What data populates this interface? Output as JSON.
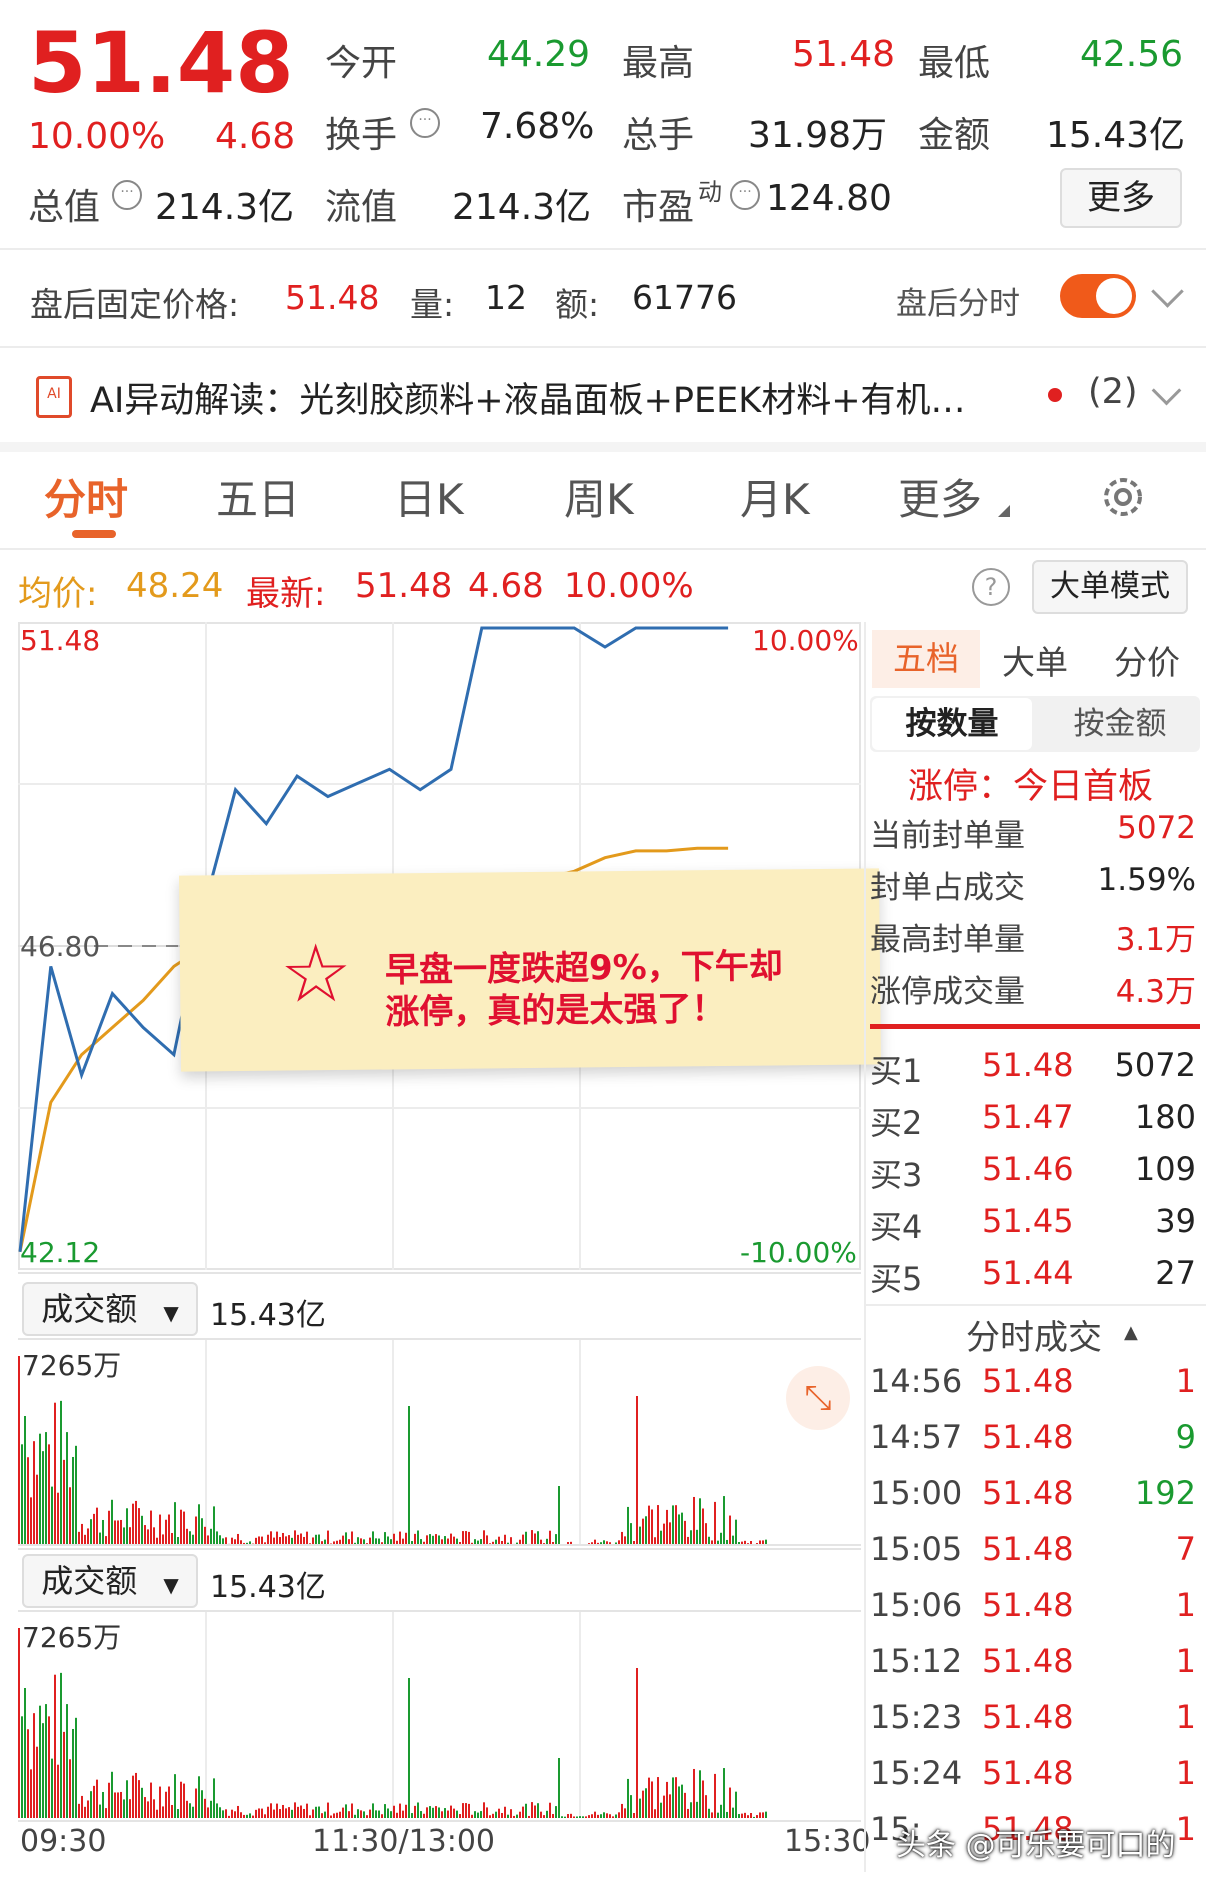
{
  "quote": {
    "price": "51.48",
    "change_pct": "10.00%",
    "change_amt": "4.68",
    "open_label": "今开",
    "open_value": "44.29",
    "high_label": "最高",
    "high_value": "51.48",
    "low_label": "最低",
    "low_value": "42.56",
    "turnover_label": "换手",
    "turnover_value": "7.68%",
    "total_hands_label": "总手",
    "total_hands_value": "31.98万",
    "amount_label": "金额",
    "amount_value": "15.43亿",
    "mktcap_label": "总值",
    "mktcap_value": "214.3亿",
    "float_label": "流值",
    "float_value": "214.3亿",
    "pe_label": "市盈",
    "pe_sup": "动",
    "pe_value": "124.80",
    "more_button": "更多"
  },
  "afterhours": {
    "price_label": "盘后固定价格:",
    "price_value": "51.48",
    "vol_label": "量:",
    "vol_value": "12",
    "amt_label": "额:",
    "amt_value": "61776",
    "timeshare_label": "盘后分时"
  },
  "ai": {
    "text": "AI异动解读：光刻胶颜料+液晶面板+PEEK材料+有机…",
    "count": "(2)"
  },
  "tabs": [
    "分时",
    "五日",
    "日K",
    "周K",
    "月K",
    "更多"
  ],
  "summary": {
    "avg_label": "均价:",
    "avg_value": "48.24",
    "latest_label": "最新:",
    "latest_value": "51.48",
    "chg": "4.68",
    "pct": "10.00%",
    "bigorder_button": "大单模式"
  },
  "chart": {
    "top_price": "51.48",
    "top_pct": "10.00%",
    "bottom_price": "42.12",
    "bottom_pct": "-10.00%",
    "ref_price": "46.80",
    "time_start": "09:30",
    "time_mid": "11:30/13:00",
    "time_end": "15:30",
    "colors": {
      "price": "#2f6db0",
      "avg": "#e39a1c",
      "up": "#e02020",
      "down": "#1a9a30"
    }
  },
  "chart_data": {
    "type": "line",
    "ylim": [
      42.12,
      51.48
    ],
    "series": [
      {
        "values": [
          42.3,
          46.5,
          44.9,
          46.1,
          45.6,
          45.2,
          47.4,
          49.1,
          48.6,
          49.3,
          49.0,
          49.2,
          49.4,
          49.1,
          49.4,
          51.48,
          51.48,
          51.48,
          51.48,
          51.2,
          51.48,
          51.48,
          51.48,
          51.48
        ]
      },
      {
        "values": [
          42.3,
          44.5,
          45.2,
          45.6,
          46.0,
          46.5,
          46.8,
          47.0,
          47.1,
          47.2,
          47.2,
          47.3,
          47.3,
          47.4,
          47.4,
          47.7,
          47.8,
          47.8,
          47.9,
          48.1,
          48.2,
          48.2,
          48.24,
          48.24
        ]
      }
    ]
  },
  "annotation": "早盘一度跌超9%，下午却涨停，真的是太强了！",
  "volume": [
    {
      "label": "成交额",
      "value": "15.43亿",
      "max": "7265万"
    },
    {
      "label": "成交额",
      "value": "15.43亿",
      "max": "7265万"
    }
  ],
  "orderbook": {
    "tabs": [
      "五档",
      "大单",
      "分价"
    ],
    "sub_tabs": [
      "按数量",
      "按金额"
    ],
    "limit_title": "涨停：今日首板",
    "stats": [
      {
        "label": "当前封单量",
        "value": "5072"
      },
      {
        "label": "封单占成交",
        "value": "1.59%"
      },
      {
        "label": "最高封单量",
        "value": "3.1万"
      },
      {
        "label": "涨停成交量",
        "value": "4.3万"
      }
    ],
    "bids": [
      {
        "label": "买1",
        "price": "51.48",
        "vol": "5072"
      },
      {
        "label": "买2",
        "price": "51.47",
        "vol": "180"
      },
      {
        "label": "买3",
        "price": "51.46",
        "vol": "109"
      },
      {
        "label": "买4",
        "price": "51.45",
        "vol": "39"
      },
      {
        "label": "买5",
        "price": "51.44",
        "vol": "27"
      }
    ],
    "trades_title": "分时成交",
    "trades": [
      {
        "time": "14:56",
        "price": "51.48",
        "vol": "1"
      },
      {
        "time": "14:57",
        "price": "51.48",
        "vol": "9"
      },
      {
        "time": "15:00",
        "price": "51.48",
        "vol": "192"
      },
      {
        "time": "15:05",
        "price": "51.48",
        "vol": "7"
      },
      {
        "time": "15:06",
        "price": "51.48",
        "vol": "1"
      },
      {
        "time": "15:12",
        "price": "51.48",
        "vol": "1"
      },
      {
        "time": "15:23",
        "price": "51.48",
        "vol": "1"
      },
      {
        "time": "15:24",
        "price": "51.48",
        "vol": "1"
      },
      {
        "time": "15:",
        "price": "51.48",
        "vol": "1"
      }
    ]
  },
  "watermark": "头条 @可乐要可口的"
}
